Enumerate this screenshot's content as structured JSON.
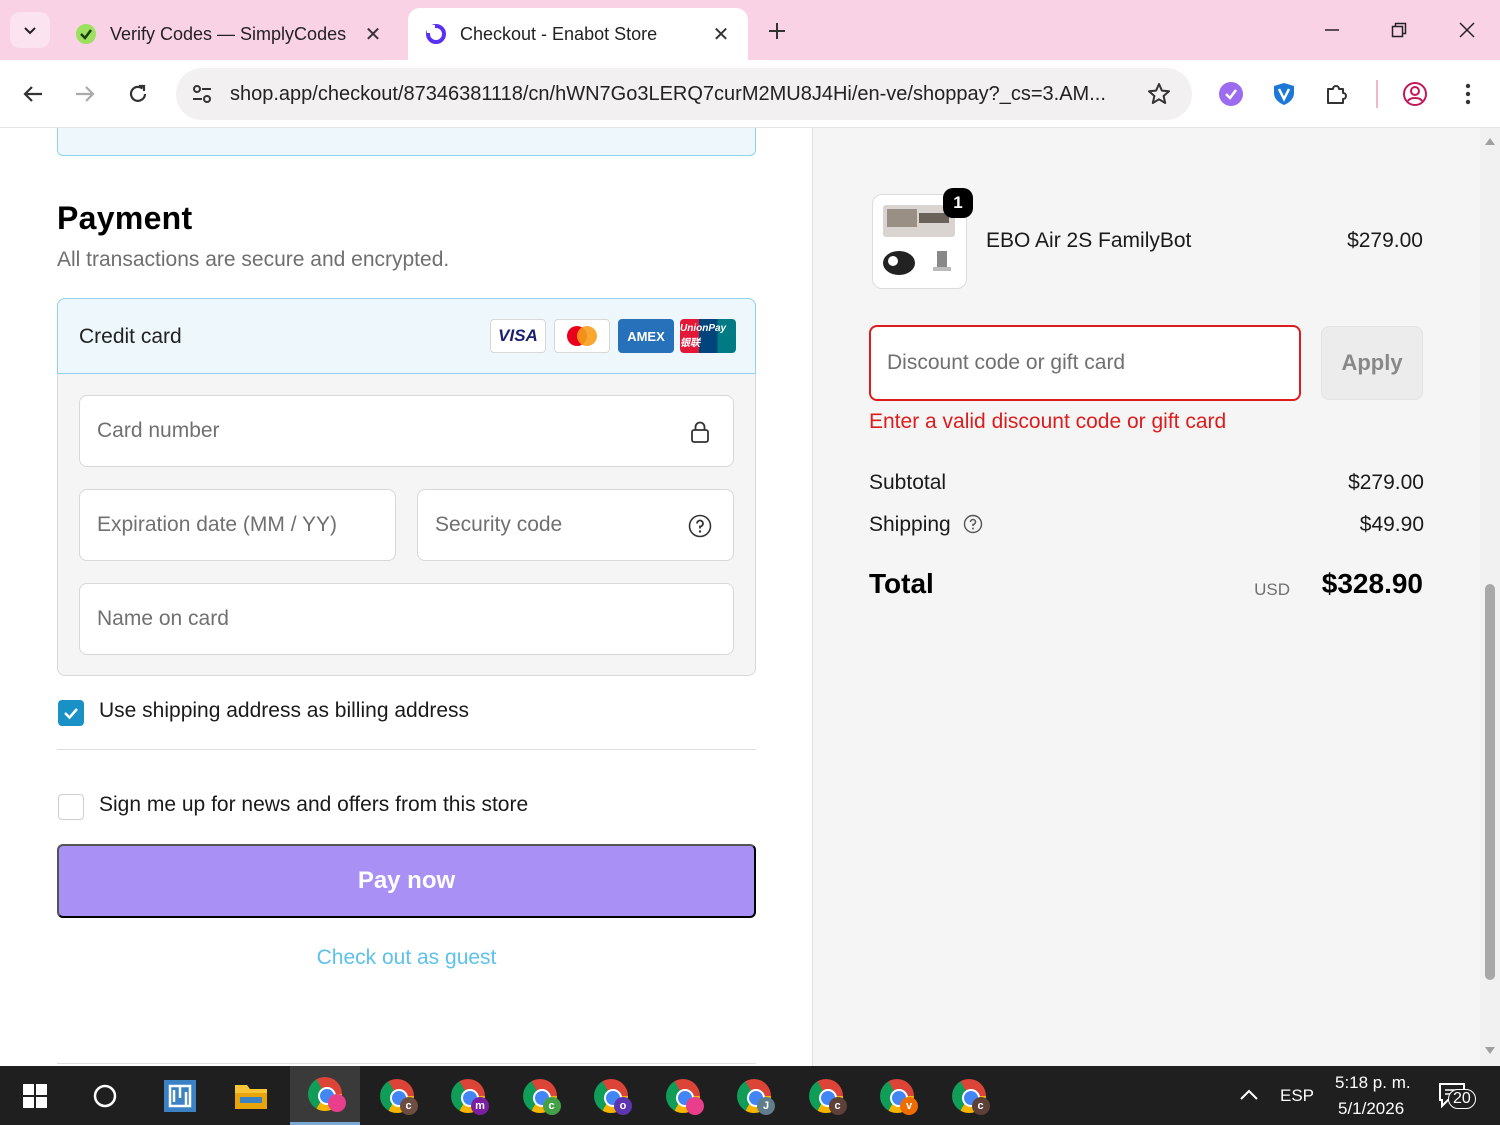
{
  "browser": {
    "tabs": [
      {
        "title": "Verify Codes — SimplyCodes",
        "active": false,
        "favicon": "simplycodes-icon"
      },
      {
        "title": "Checkout - Enabot Store",
        "active": true,
        "favicon": "shop-icon"
      }
    ],
    "url": "shop.app/checkout/87346381118/cn/hWN7Go3LERQ7curM2MU8J4Hi/en-ve/shoppay?_cs=3.AM...",
    "extensions": [
      "simplycodes-ext-icon",
      "shield-ext-icon",
      "puzzle-icon",
      "profile-icon",
      "menu-icon"
    ]
  },
  "payment": {
    "title": "Payment",
    "subtitle": "All transactions are secure and encrypted.",
    "method_label": "Credit card",
    "brands": [
      "VISA",
      "MASTERCARD",
      "AMEX",
      "UnionPay 银联"
    ],
    "card_number_placeholder": "Card number",
    "expiration_placeholder": "Expiration date (MM / YY)",
    "security_code_placeholder": "Security code",
    "name_placeholder": "Name on card",
    "billing_checkbox_label": "Use shipping address as billing address",
    "billing_checked": true,
    "newsletter_checkbox_label": "Sign me up for news and offers from this store",
    "newsletter_checked": false,
    "pay_button": "Pay now",
    "guest_link": "Check out as guest"
  },
  "summary": {
    "product": {
      "name": "EBO Air 2S FamilyBot",
      "price": "$279.00",
      "quantity": "1"
    },
    "discount_placeholder": "Discount code or gift card",
    "apply_button": "Apply",
    "discount_error": "Enter a valid discount code or gift card",
    "subtotal_label": "Subtotal",
    "subtotal_value": "$279.00",
    "shipping_label": "Shipping",
    "shipping_value": "$49.90",
    "total_label": "Total",
    "total_currency": "USD",
    "total_value": "$328.90"
  },
  "taskbar": {
    "chrome_profiles": [
      {
        "letter": "",
        "color": "#e83e8c",
        "icon": "avatar"
      },
      {
        "letter": "c",
        "color": "#6d4c41"
      },
      {
        "letter": "m",
        "color": "#7b1fa2"
      },
      {
        "letter": "c",
        "color": "#43a047"
      },
      {
        "letter": "o",
        "color": "#5e35b1"
      },
      {
        "letter": "",
        "color": "#e83e8c",
        "icon": "avatar"
      },
      {
        "letter": "J",
        "color": "#607d8b"
      },
      {
        "letter": "c",
        "color": "#5d4037"
      },
      {
        "letter": "v",
        "color": "#ef6c00"
      },
      {
        "letter": "c",
        "color": "#5d4037"
      }
    ],
    "language": "ESP",
    "time": "5:18 p. m.",
    "date": "5/1/2026",
    "notifications": "20"
  },
  "colors": {
    "tab_strip": "#f9d2e6",
    "pay_button": "#a990f5",
    "link": "#5cc2ec",
    "error": "#dd1d1d",
    "checkbox": "#1990c6"
  }
}
